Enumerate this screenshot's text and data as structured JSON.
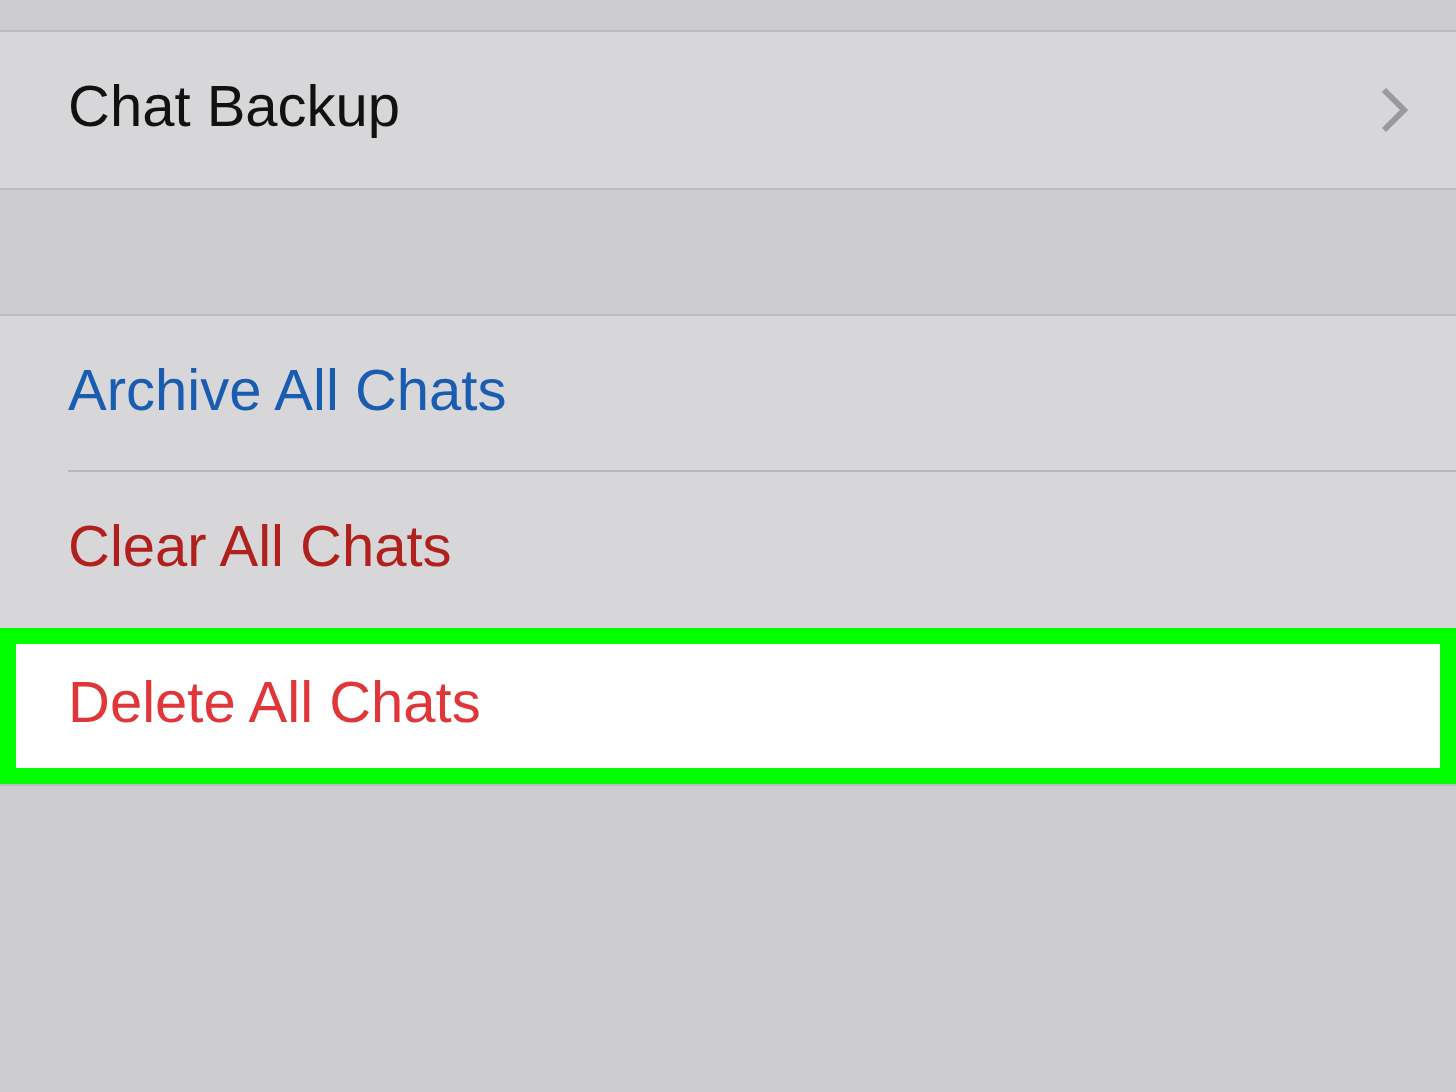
{
  "sections": [
    {
      "rows": [
        {
          "label": "Chat Backup",
          "kind": "nav",
          "color": "#111111",
          "highlighted": false
        }
      ]
    },
    {
      "rows": [
        {
          "label": "Archive All Chats",
          "kind": "action",
          "color": "#1a5cb0",
          "highlighted": false
        },
        {
          "label": "Clear All Chats",
          "kind": "action",
          "color": "#b0201c",
          "highlighted": false
        },
        {
          "label": "Delete All Chats",
          "kind": "action",
          "color": "#e0363a",
          "highlighted": true
        }
      ]
    }
  ]
}
